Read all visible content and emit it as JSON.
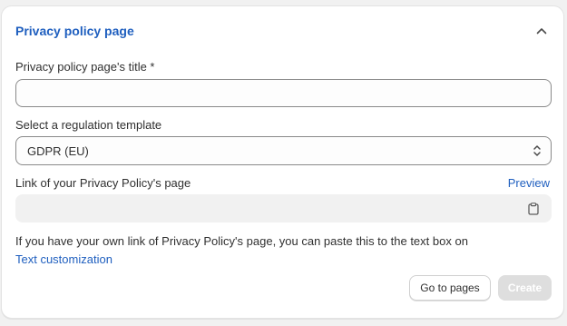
{
  "section": {
    "title": "Privacy policy page"
  },
  "title_field": {
    "label": "Privacy policy page's title *",
    "value": "",
    "placeholder": ""
  },
  "regulation_select": {
    "label": "Select a regulation template",
    "selected": "GDPR (EU)"
  },
  "link_field": {
    "label": "Link of your Privacy Policy's page",
    "preview_label": "Preview",
    "value": ""
  },
  "help": {
    "text": "If you have your own link of Privacy Policy's page, you can paste this to the text box on",
    "link_label": "Text customization"
  },
  "actions": {
    "go_to_pages_label": "Go to pages",
    "create_label": "Create"
  },
  "colors": {
    "accent": "#1f5fbf",
    "disabled_button": "#dedede",
    "readonly_bg": "#f1f1f1"
  },
  "icons": {
    "collapse": "chevron-up-icon",
    "select": "select-chevrons-icon",
    "copy": "clipboard-icon"
  }
}
